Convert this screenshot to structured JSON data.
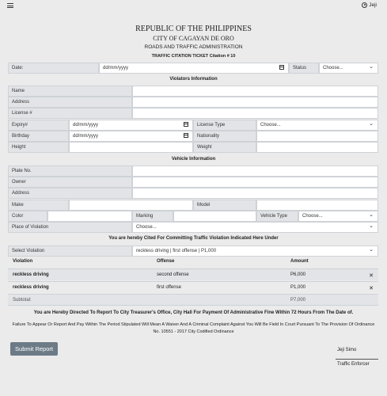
{
  "topbar": {
    "user_name": "Jeji"
  },
  "header": {
    "republic": "REPUBLIC OF THE PHILIPPINES",
    "city": "CITY OF CAGAYAN DE ORO",
    "agency": "ROADS AND TRAFFIC ADMINISTRATION",
    "ticket": "TRAFFIC CITATION TICKET Citation # 10"
  },
  "top_row": {
    "date_label": "Date:",
    "date_placeholder": "dd/mm/yyyy",
    "status_label": "Status",
    "status_value": "Choose..."
  },
  "violator": {
    "section_title": "Violators Information",
    "name_label": "Name",
    "address_label": "Address",
    "license_label": "License #",
    "expiry_label": "Expiry#",
    "expiry_placeholder": "dd/mm/yyyy",
    "license_type_label": "License Type",
    "license_type_value": "Choose...",
    "birthday_label": "Birthday",
    "birthday_placeholder": "dd/mm/yyyy",
    "nationality_label": "Nationality",
    "height_label": "Height",
    "weight_label": "Weight"
  },
  "vehicle": {
    "section_title": "Vehicle Information",
    "plate_label": "Plate No.",
    "owner_label": "Owner",
    "address_label": "Address",
    "make_label": "Make",
    "model_label": "Model",
    "color_label": "Color",
    "marking_label": "Marking",
    "vehicle_type_label": "Vehicle Type",
    "vehicle_type_value": "Choose...",
    "place_label": "Place of Violation",
    "place_value": "Choose..."
  },
  "violations": {
    "section_title": "You are hereby Cited For Committing Traffic Violation Indicated Here Under",
    "select_label": "Select Violation",
    "select_value": "reckless driving | first offense | P1,000",
    "col_violation": "Violation",
    "col_offense": "Offense",
    "col_amount": "Amount",
    "rows": [
      {
        "violation": "reckless driving",
        "offense": "second offense",
        "amount": "P6,000"
      },
      {
        "violation": "reckless driving",
        "offense": "first offense",
        "amount": "P1,000"
      }
    ],
    "subtotal_label": "Subtotal:",
    "subtotal_value": "P7,000"
  },
  "notice": {
    "line1": "You are Hereby Directed To Report To City Treasurer's Office, City Hall For Payment Of Administrative Fine Within 72 Hours From The Date of.",
    "line2": "Failure To Appear Or Report And Pay Within The Period Stipulated Will Mean A Waiver And A Criminal Complaint Against You Will Be Field In Court Pursuant To The Provision Of Ordinance No. 10551 - 2017 City Codified Ordinance"
  },
  "footer": {
    "submit_label": "Submit Report",
    "enforcer_name": "Jeji Simo",
    "enforcer_title": "Traffic Enforcer"
  }
}
